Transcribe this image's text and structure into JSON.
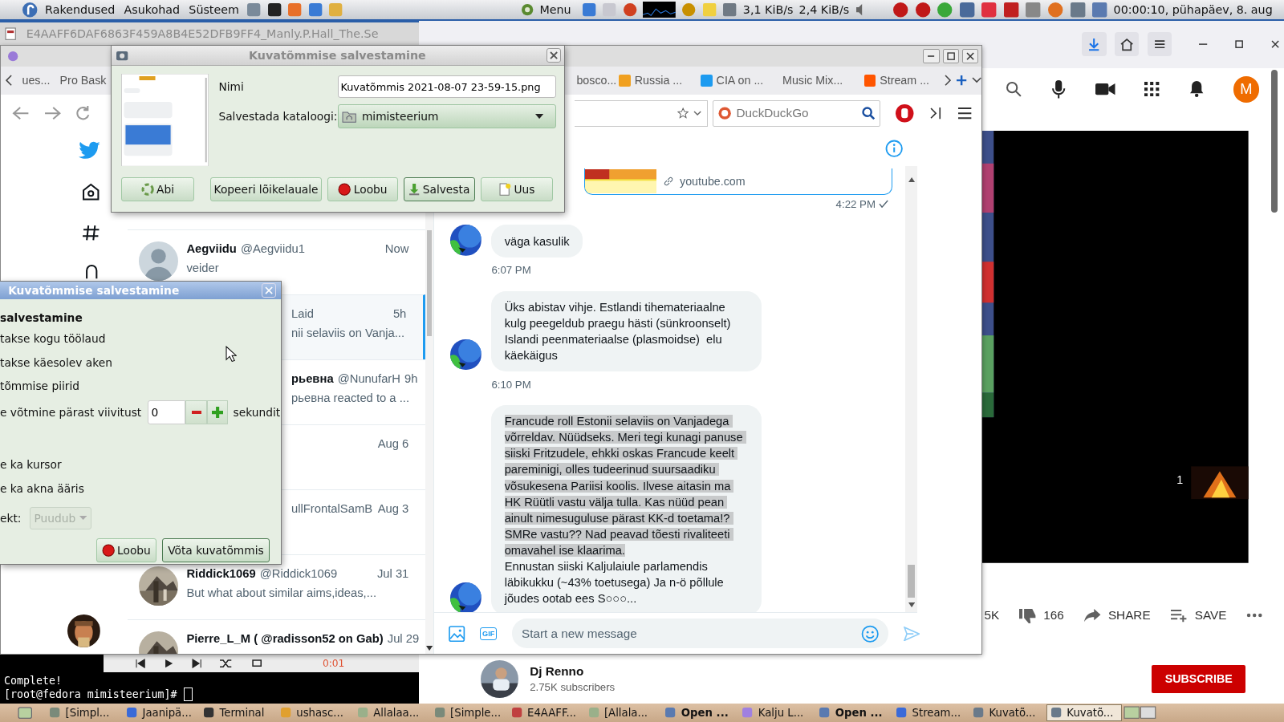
{
  "top_panel": {
    "menus": [
      "Rakendused",
      "Asukohad",
      "Süsteem"
    ],
    "menu_button": "Menu",
    "download_rate": "3,1 KiB/s",
    "upload_rate": "2,4 KiB/s",
    "clock": "00:00:10, pühapäev,  8. aug"
  },
  "background_window": {
    "title": "E4AAFF6DAF6863F459A8B4E52DFB9FF4_Manly.P.Hall_The.Se"
  },
  "browser": {
    "tabs_left": [
      {
        "label": "ues...",
        "selected": false
      },
      {
        "label": "Pro Bask",
        "selected": false
      }
    ],
    "tabs_right": [
      {
        "label": "bosco...",
        "kind": "plain",
        "selected": false
      },
      {
        "label": "Russia ...",
        "kind": "square",
        "selected": false
      },
      {
        "label": "CIA on ...",
        "kind": "bird",
        "selected": false
      },
      {
        "label": "Music Mix...",
        "kind": "plain",
        "selected": false
      },
      {
        "label": "Stream ...",
        "kind": "cloud",
        "selected": false
      }
    ],
    "search": {
      "placeholder": "DuckDuckGo"
    }
  },
  "twitter": {
    "conversations": [
      {
        "kind": "silhouette",
        "name": "Aegviidu",
        "handle": "@Aegviidu1",
        "time": "Now",
        "preview": "veider",
        "selected": false
      },
      {
        "kind": "partial",
        "handle": "Laid",
        "time": "5h",
        "preview": "nii selaviis on Vanja...",
        "selected": true
      },
      {
        "kind": "partial",
        "name": "рьевна",
        "handle": "@NunufarH",
        "time": "9h",
        "preview": "рьевна reacted to a ...",
        "selected": false
      },
      {
        "kind": "partial",
        "time": "Aug 6",
        "selected": false
      },
      {
        "kind": "partial",
        "handle": "ullFrontalSamB",
        "time": "Aug 3",
        "selected": false
      },
      {
        "kind": "picture",
        "name": "Riddick1069",
        "handle": "@Riddick1069",
        "time": "Jul 31",
        "preview": "But what about similar aims,ideas,...",
        "selected": false
      },
      {
        "kind": "picture",
        "name": "Pierre_L_M ( @radisson52 on Gab)",
        "time": "Jul 29",
        "selected": false
      }
    ],
    "chat": {
      "link_domain": "youtube.com",
      "link_time": "4:22 PM",
      "messages": [
        {
          "text": "väga kasulik",
          "time": "6:07 PM"
        },
        {
          "text": "Üks abistav vihje. Estlandi tihemateriaalne kulg peegeldub praegu hästi (sünkroonselt) Islandi peenmateriaalse (plasmoidse)  elu käekäigus",
          "time": "6:10 PM"
        },
        {
          "highlighted": "Francude roll Estonii selaviis on Vanjadega võrreldav. Nüüdseks. Meri tegi kunagi panuse siiski Fritzudele, ehkki oskas Francude keelt pareminigi, olles tudeerinud suursaadiku võsukesena Pariisi koolis. Ilvese aitasin ma HK Rüütli vastu välja tulla. Kas nüüd pean ainult nimesuguluse pärast KK-d toetama!? SMRe vastu?? Nad peavad tõesti rivaliteeti omavahel ise klaarima.",
          "text": "Ennustan siiski Kaljulaiule parlamendis läbikukku (~43% toetusega) Ja n-ö põllule jõudes ootab ees S○○○..."
        }
      ],
      "composer": {
        "placeholder": "Start a new message",
        "gif_label": "GIF"
      }
    }
  },
  "save_dialog": {
    "title": "Kuvatõmmise salvestamine",
    "name_label": "Nimi",
    "name_value": "Kuvatõmmis 2021-08-07 23-59-15.png",
    "folder_label": "Salvestada kataloogi:",
    "folder": "mimisteerium",
    "buttons": [
      {
        "label": "Abi",
        "kind": "help",
        "default": false
      },
      {
        "label": "Kopeeri lõikelauale",
        "kind": "plain",
        "default": false
      },
      {
        "label": "Loobu",
        "kind": "cancel",
        "default": false
      },
      {
        "label": "Salvesta",
        "kind": "save",
        "default": true
      },
      {
        "label": "Uus",
        "kind": "new",
        "default": false
      }
    ]
  },
  "capture_dialog": {
    "title": "Kuvatõmmise salvestamine",
    "heading": "salvestamine",
    "options": [
      "takse kogu töölaud",
      "takse käesolev aken",
      "tõmmise piirid"
    ],
    "delay_label": "e võtmine pärast viivitust",
    "delay_value": "0",
    "delay_unit": "sekundit",
    "effects": [
      "e ka kursor",
      "e ka akna ääris"
    ],
    "effect_label": "ekt:",
    "effect_value": "Puudub",
    "effect_disabled": true,
    "buttons": [
      {
        "label": "Loobu",
        "kind": "cancel",
        "default": false
      },
      {
        "label": "Võta kuvatõmmis",
        "kind": "plain",
        "default": true
      }
    ]
  },
  "youtube": {
    "account_initial": "M",
    "playlist_index": "1",
    "likes": "5K",
    "dislikes": "166",
    "share": "SHARE",
    "save": "SAVE",
    "channel": "Dj Renno",
    "subscribers": "2.75K subscribers",
    "subscribe": "SUBSCRIBE"
  },
  "terminal": {
    "player_time": "0:01",
    "lines": [
      "Complete!",
      "[root@fedora mimisteerium]#"
    ]
  },
  "taskbar": {
    "items": [
      {
        "label": "[Simpl...",
        "attention": false,
        "selected": false
      },
      {
        "label": "Jaanipä...",
        "attention": false,
        "selected": false
      },
      {
        "label": "Terminal",
        "attention": false,
        "selected": false
      },
      {
        "label": "ushasc...",
        "attention": false,
        "selected": false
      },
      {
        "label": "Allalaa...",
        "attention": false,
        "selected": false
      },
      {
        "label": "[Simple...",
        "attention": false,
        "selected": false
      },
      {
        "label": "E4AAFF...",
        "attention": false,
        "selected": false
      },
      {
        "label": "[Allala...",
        "attention": false,
        "selected": false
      },
      {
        "label": "Open ...",
        "attention": true,
        "selected": false
      },
      {
        "label": "Kalju L...",
        "attention": false,
        "selected": false
      },
      {
        "label": "Open ...",
        "attention": true,
        "selected": false
      },
      {
        "label": "Stream...",
        "attention": false,
        "selected": false
      },
      {
        "label": "Kuvatõ...",
        "attention": false,
        "selected": false
      },
      {
        "label": "Kuvatõ...",
        "attention": false,
        "selected": true
      }
    ]
  }
}
